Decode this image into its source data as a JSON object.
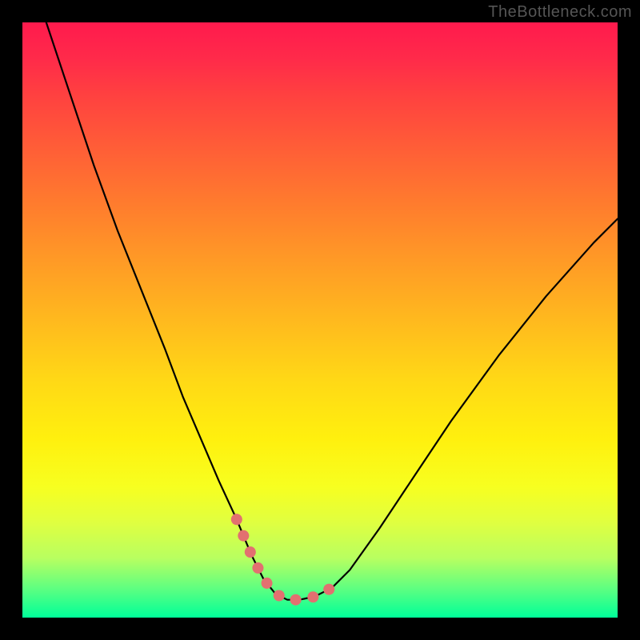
{
  "watermark": "TheBottleneck.com",
  "chart_data": {
    "type": "line",
    "title": "",
    "xlabel": "",
    "ylabel": "",
    "xlim": [
      0,
      1
    ],
    "ylim": [
      0,
      1
    ],
    "series": [
      {
        "name": "bottleneck-curve",
        "x": [
          0.04,
          0.08,
          0.12,
          0.16,
          0.2,
          0.24,
          0.27,
          0.3,
          0.33,
          0.36,
          0.385,
          0.405,
          0.425,
          0.445,
          0.465,
          0.49,
          0.52,
          0.55,
          0.6,
          0.66,
          0.72,
          0.8,
          0.88,
          0.96,
          1.0
        ],
        "values": [
          1.0,
          0.88,
          0.76,
          0.65,
          0.55,
          0.45,
          0.37,
          0.3,
          0.23,
          0.165,
          0.105,
          0.065,
          0.04,
          0.03,
          0.03,
          0.035,
          0.05,
          0.08,
          0.15,
          0.24,
          0.33,
          0.44,
          0.54,
          0.63,
          0.67
        ]
      }
    ],
    "annotations": {
      "optimal_segment": {
        "color": "#e27070",
        "x": [
          0.36,
          0.385,
          0.405,
          0.425,
          0.445,
          0.465,
          0.49,
          0.52
        ],
        "values": [
          0.165,
          0.105,
          0.065,
          0.04,
          0.03,
          0.03,
          0.035,
          0.05
        ]
      }
    },
    "gradient_stops": [
      {
        "pos": 0.0,
        "color": "#ff1a4d"
      },
      {
        "pos": 0.5,
        "color": "#ffd816"
      },
      {
        "pos": 1.0,
        "color": "#00ff99"
      }
    ]
  }
}
